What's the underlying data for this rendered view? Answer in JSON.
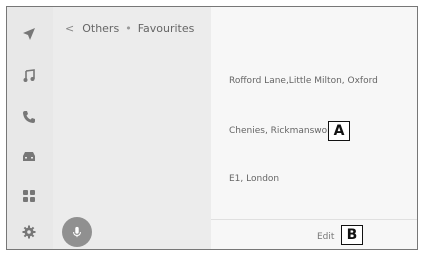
{
  "breadcrumb": {
    "back": "<",
    "parent": "Others",
    "separator": "•",
    "current": "Favourites"
  },
  "rail": {
    "icons": [
      "navigation-icon",
      "music-icon",
      "phone-icon",
      "car-icon",
      "apps-icon",
      "settings-icon"
    ]
  },
  "favourites": [
    "Rofford Lane,Little Milton, Oxford",
    "Chenies, Rickmansworth",
    "E1, London"
  ],
  "edit_label": "Edit",
  "callouts": {
    "a": "A",
    "b": "B"
  },
  "colors": {
    "rail": "#e8e8e8",
    "mic": "#909090"
  }
}
